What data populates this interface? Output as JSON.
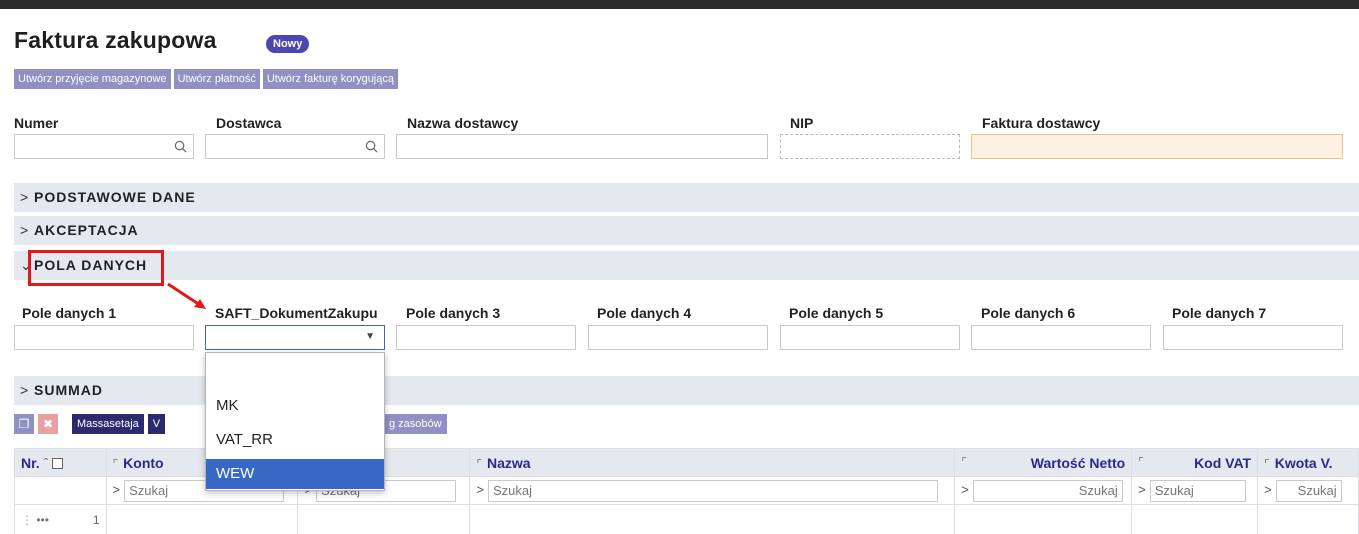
{
  "title": "Faktura zakupowa",
  "status_badge": "Nowy",
  "actions": [
    "Utwórz przyjęcie magazynowe",
    "Utwórz płatność",
    "Utwórz fakturę korygującą"
  ],
  "header_fields": {
    "numer": "Numer",
    "dostawca": "Dostawca",
    "nazwa_dostawcy": "Nazwa dostawcy",
    "nip": "NIP",
    "faktura_dostawcy": "Faktura dostawcy"
  },
  "sections": {
    "podstawowe": "PODSTAWOWE DANE",
    "akceptacja": "AKCEPTACJA",
    "pola": "POLA DANYCH",
    "summad": "SUMMAD"
  },
  "data_fields": [
    "Pole danych 1",
    "SAFT_DokumentZakupu",
    "Pole danych 3",
    "Pole danych 4",
    "Pole danych 5",
    "Pole danych 6",
    "Pole danych 7"
  ],
  "dropdown": {
    "options": [
      "",
      "MK",
      "VAT_RR",
      "WEW"
    ],
    "highlighted": "WEW"
  },
  "toolbar": {
    "massasetaja": "Massasetaja",
    "partial_v": "V",
    "partial_zasobow": "g zasobów"
  },
  "grid": {
    "headers": {
      "nr": "Nr.",
      "konto": "Konto",
      "nazwa": "Nazwa",
      "wartosc": "Wartość Netto",
      "kod_vat": "Kod VAT",
      "kwota": "Kwota V."
    },
    "search": "Szukaj",
    "row_number": "1"
  },
  "colors": {
    "accent": "#4b46b5",
    "button": "#8f90c4",
    "section_bg": "#e4e8ef",
    "highlight": "#e01a1a",
    "selected": "#3868c6"
  }
}
